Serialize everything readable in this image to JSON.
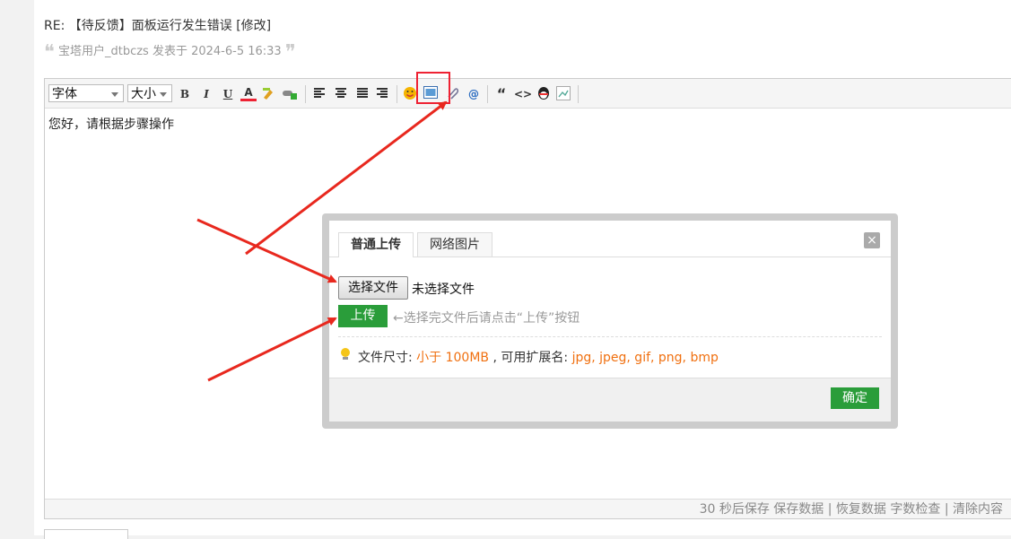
{
  "post": {
    "title": "RE: 【待反馈】面板运行发生错误 [修改]",
    "author_line": "宝塔用户_dtbczs 发表于 2024-6-5 16:33"
  },
  "toolbar": {
    "font_label": "字体",
    "size_label": "大小",
    "bold": "B",
    "italic": "I",
    "underline": "U",
    "font_color": "A",
    "at": "@",
    "quote": "“",
    "code": "<>"
  },
  "editor": {
    "body_text": "您好，请根据步骤操作",
    "status_text": "30 秒后保存 保存数据 | 恢复数据    字数检查 | 清除内容"
  },
  "dialog": {
    "tabs": [
      {
        "label": "普通上传",
        "active": true
      },
      {
        "label": "网络图片",
        "active": false
      }
    ],
    "close_label": "×",
    "choose_file_label": "选择文件",
    "file_status": "未选择文件",
    "upload_label": "上传",
    "upload_hint": "←选择完文件后请点击“上传”按钮",
    "size_label": "文件尺寸: ",
    "size_value": "小于 100MB",
    "ext_label": " , 可用扩展名: ",
    "ext_value": "jpg, jpeg, gif, png, bmp",
    "ok_label": "确定"
  },
  "colors": {
    "accent_green": "#2a9d3a",
    "highlight_red": "#e23",
    "info_orange": "#f07010"
  }
}
